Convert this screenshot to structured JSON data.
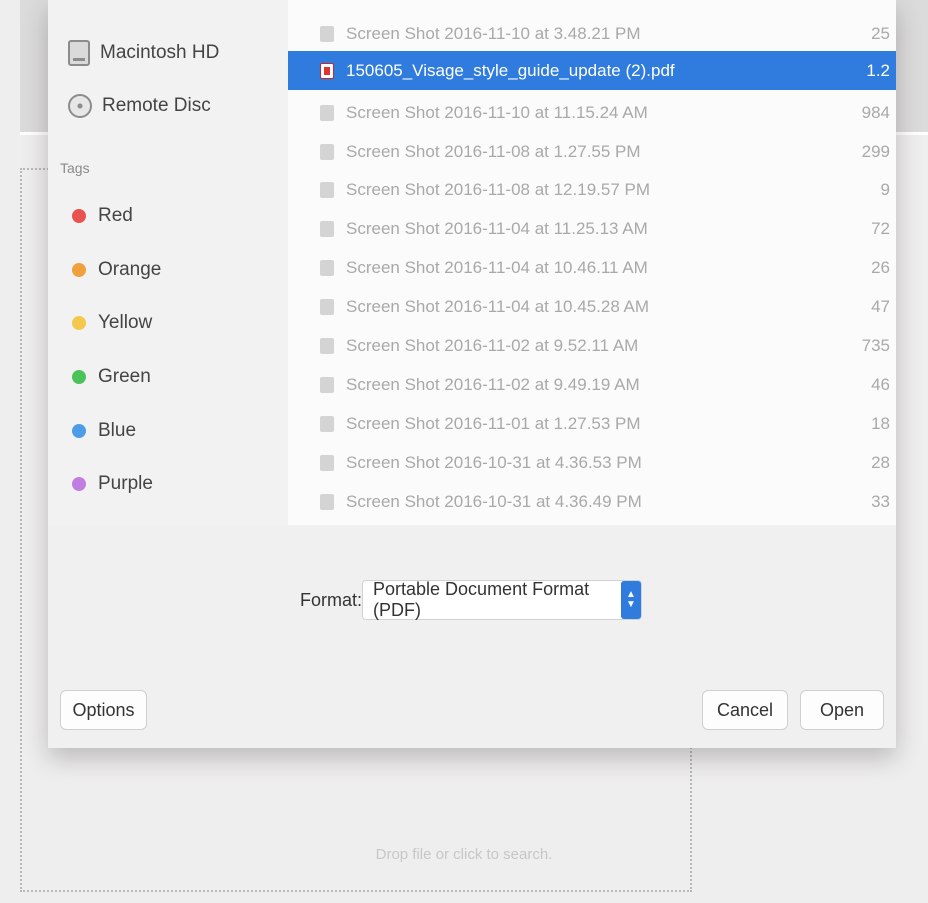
{
  "sidebar": {
    "devices": [
      {
        "label": "Macintosh HD",
        "icon": "hard-drive-icon"
      },
      {
        "label": "Remote Disc",
        "icon": "disc-icon"
      }
    ],
    "tags_title": "Tags",
    "tags": [
      {
        "label": "Red",
        "color": "#e9534f"
      },
      {
        "label": "Orange",
        "color": "#f0a03c"
      },
      {
        "label": "Yellow",
        "color": "#f2c94c"
      },
      {
        "label": "Green",
        "color": "#4cc25b"
      },
      {
        "label": "Blue",
        "color": "#4c9de6"
      },
      {
        "label": "Purple",
        "color": "#c27de0"
      }
    ]
  },
  "files": [
    {
      "name": "Screen Shot 2016-11-10 at 3.48.21 PM",
      "size": "25",
      "icon": "image-icon"
    },
    {
      "name": "150605_Visage_style_guide_update (2).pdf",
      "size": "1.2",
      "icon": "pdf-icon",
      "selected": true
    },
    {
      "name": "Screen Shot 2016-11-10 at 11.15.24 AM",
      "size": "984",
      "icon": "image-icon"
    },
    {
      "name": "Screen Shot 2016-11-08 at 1.27.55 PM",
      "size": "299",
      "icon": "image-icon"
    },
    {
      "name": "Screen Shot 2016-11-08 at 12.19.57 PM",
      "size": "9",
      "icon": "image-icon"
    },
    {
      "name": "Screen Shot 2016-11-04 at 11.25.13 AM",
      "size": "72",
      "icon": "image-icon"
    },
    {
      "name": "Screen Shot 2016-11-04 at 10.46.11 AM",
      "size": "26",
      "icon": "image-icon"
    },
    {
      "name": "Screen Shot 2016-11-04 at 10.45.28 AM",
      "size": "47",
      "icon": "image-icon"
    },
    {
      "name": "Screen Shot 2016-11-02 at 9.52.11 AM",
      "size": "735",
      "icon": "image-icon"
    },
    {
      "name": "Screen Shot 2016-11-02 at 9.49.19 AM",
      "size": "46",
      "icon": "image-icon"
    },
    {
      "name": "Screen Shot 2016-11-01 at 1.27.53 PM",
      "size": "18",
      "icon": "image-icon"
    },
    {
      "name": "Screen Shot 2016-10-31 at 4.36.53 PM",
      "size": "28",
      "icon": "image-icon"
    },
    {
      "name": "Screen Shot 2016-10-31 at 4.36.49 PM",
      "size": "33",
      "icon": "image-icon"
    }
  ],
  "format": {
    "label": "Format:",
    "value": "Portable Document Format (PDF)"
  },
  "buttons": {
    "options": "Options",
    "cancel": "Cancel",
    "open": "Open"
  },
  "dropzone": {
    "text": "Drop file or click to search."
  },
  "colors": {
    "accent": "#2f7cde"
  }
}
